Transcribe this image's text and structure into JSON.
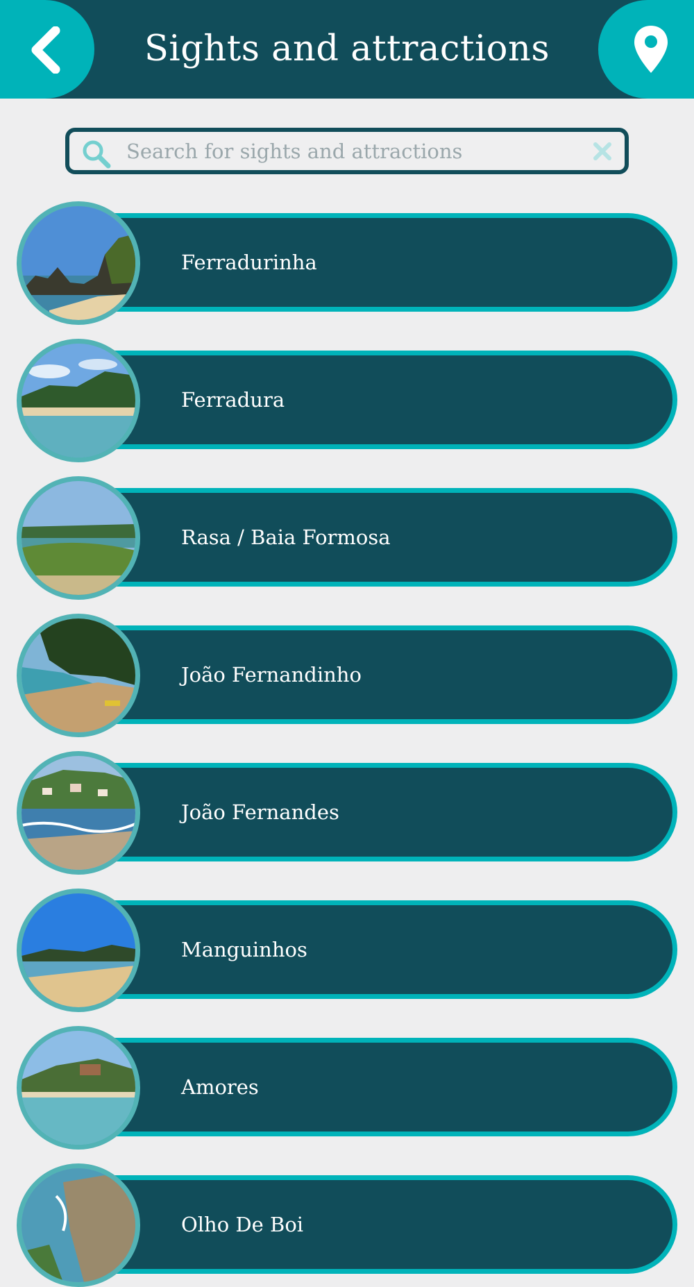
{
  "header": {
    "title": "Sights and attractions",
    "back_icon": "chevron-left-icon",
    "map_icon": "map-pin-icon"
  },
  "search": {
    "placeholder": "Search for sights and attractions",
    "value": "",
    "search_icon": "search-icon",
    "clear_icon": "close-icon"
  },
  "items": [
    {
      "label": "Ferradurinha",
      "image": "beach-rocks-photo"
    },
    {
      "label": "Ferradura",
      "image": "bay-beach-photo"
    },
    {
      "label": "Rasa / Baia Formosa",
      "image": "coast-vegetation-photo"
    },
    {
      "label": "João Fernandinho",
      "image": "cliff-beach-photo"
    },
    {
      "label": "João Fernandes",
      "image": "town-beach-photo"
    },
    {
      "label": "Manguinhos",
      "image": "sandy-shore-photo"
    },
    {
      "label": "Amores",
      "image": "cove-hill-photo"
    },
    {
      "label": "Olho De Boi",
      "image": "rocky-coast-photo"
    }
  ],
  "colors": {
    "header_bg": "#114d5a",
    "accent": "#00b3b9",
    "page_bg": "#eeeeef",
    "text_light": "#ffffff"
  }
}
